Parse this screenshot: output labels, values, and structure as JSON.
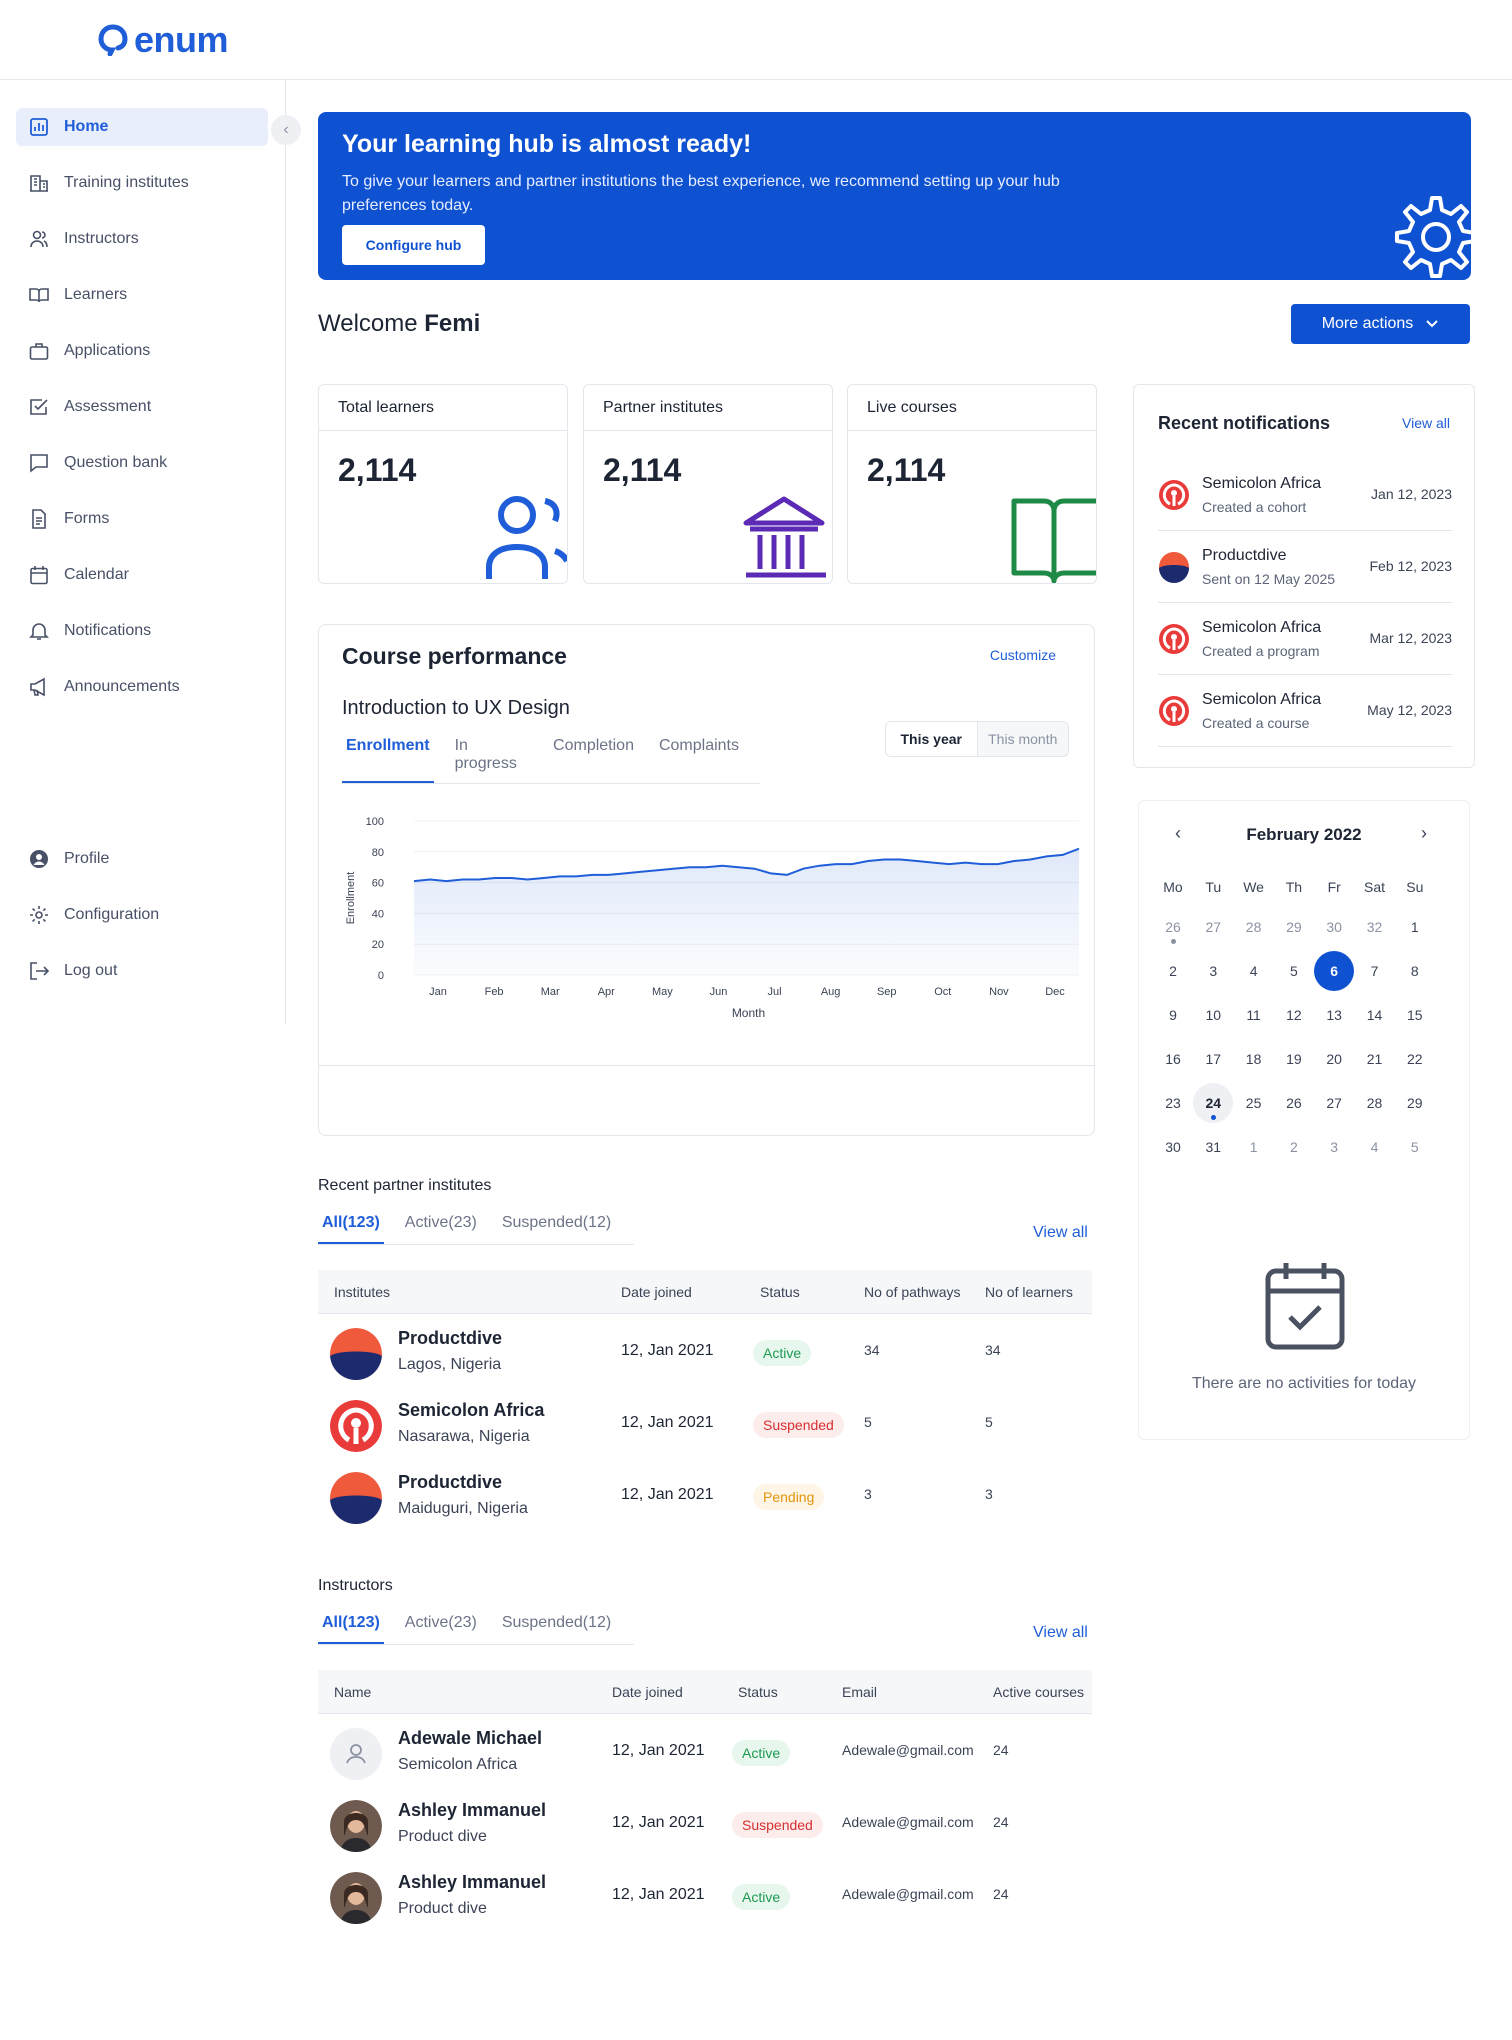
{
  "brand": {
    "name": "enum"
  },
  "sidebar": {
    "items": [
      {
        "label": "Home",
        "icon": "chart-icon"
      },
      {
        "label": "Training institutes",
        "icon": "building-icon"
      },
      {
        "label": "Instructors",
        "icon": "users-icon"
      },
      {
        "label": "Learners",
        "icon": "book-icon"
      },
      {
        "label": "Applications",
        "icon": "briefcase-icon"
      },
      {
        "label": "Assessment",
        "icon": "checkbox-icon"
      },
      {
        "label": "Question bank",
        "icon": "message-icon"
      },
      {
        "label": "Forms",
        "icon": "document-icon"
      },
      {
        "label": "Calendar",
        "icon": "calendar-icon"
      },
      {
        "label": "Notifications",
        "icon": "bell-icon"
      },
      {
        "label": "Announcements",
        "icon": "megaphone-icon"
      }
    ],
    "bottom": [
      {
        "label": "Profile",
        "icon": "profile-icon"
      },
      {
        "label": "Configuration",
        "icon": "gear-icon"
      },
      {
        "label": "Log out",
        "icon": "logout-icon"
      }
    ]
  },
  "banner": {
    "title": "Your learning hub is almost ready!",
    "text": "To give your learners and partner institutions the best experience, we recommend setting up your hub preferences today.",
    "button": "Configure hub"
  },
  "welcome": {
    "prefix": "Welcome ",
    "name": "Femi"
  },
  "more_actions": "More actions",
  "stats": [
    {
      "label": "Total learners",
      "value": "2,114"
    },
    {
      "label": "Partner institutes",
      "value": "2,114"
    },
    {
      "label": "Live courses",
      "value": "2,114"
    }
  ],
  "notifications": {
    "title": "Recent notifications",
    "view_all": "View all",
    "items": [
      {
        "name": "Semicolon Africa",
        "desc": "Created a cohort",
        "date": "Jan 12, 2023"
      },
      {
        "name": "Productdive",
        "desc": "Sent on 12 May 2025",
        "date": "Feb 12, 2023"
      },
      {
        "name": "Semicolon Africa",
        "desc": "Created a program",
        "date": "Mar 12, 2023"
      },
      {
        "name": "Semicolon Africa",
        "desc": "Created a course",
        "date": "May 12, 2023"
      }
    ]
  },
  "performance": {
    "title": "Course performance",
    "customize": "Customize",
    "course": "Introduction to UX Design",
    "tabs": [
      "Enrollment",
      "In progress",
      "Completion",
      "Complaints"
    ],
    "period": [
      "This year",
      "This month"
    ]
  },
  "chart_data": {
    "type": "area",
    "xlabel": "Month",
    "ylabel": "Enrollment",
    "ylim": [
      0,
      100
    ],
    "yticks": [
      0,
      20,
      40,
      60,
      80,
      100
    ],
    "categories": [
      "Jan",
      "Feb",
      "Mar",
      "Apr",
      "May",
      "Jun",
      "Jul",
      "Aug",
      "Sep",
      "Oct",
      "Nov",
      "Dec"
    ],
    "series": [
      {
        "values": [
          61,
          62,
          61,
          62,
          62,
          63,
          63,
          62,
          63,
          64,
          64,
          65,
          65,
          66,
          67,
          68,
          69,
          70,
          70,
          71,
          70,
          69,
          66,
          65,
          69,
          71,
          72,
          72,
          74,
          75,
          75,
          74,
          73,
          72,
          73,
          72,
          72,
          74,
          75,
          77,
          78,
          82
        ]
      }
    ],
    "color": "#1f5ed8"
  },
  "calendar": {
    "title": "February 2022",
    "dow": [
      "Mo",
      "Tu",
      "We",
      "Th",
      "Fr",
      "Sat",
      "Su"
    ],
    "weeks": [
      [
        "26",
        "27",
        "28",
        "29",
        "30",
        "32",
        "1"
      ],
      [
        "2",
        "3",
        "4",
        "5",
        "6",
        "7",
        "8"
      ],
      [
        "9",
        "10",
        "11",
        "12",
        "13",
        "14",
        "15"
      ],
      [
        "16",
        "17",
        "18",
        "19",
        "20",
        "21",
        "22"
      ],
      [
        "23",
        "24",
        "25",
        "26",
        "27",
        "28",
        "29"
      ],
      [
        "30",
        "31",
        "1",
        "2",
        "3",
        "4",
        "5"
      ]
    ],
    "selected": "6",
    "today": "24",
    "empty": "There are no activities for today"
  },
  "partners": {
    "title": "Recent partner institutes",
    "tabs": [
      "All(123)",
      "Active(23)",
      "Suspended(12)"
    ],
    "view_all": "View all",
    "columns": [
      "Institutes",
      "Date joined",
      "Status",
      "No of pathways",
      "No of learners"
    ],
    "rows": [
      {
        "name": "Productdive",
        "location": "Lagos, Nigeria",
        "date": "12, Jan 2021",
        "status": "Active",
        "pathways": "34",
        "learners": "34"
      },
      {
        "name": "Semicolon Africa",
        "location": "Nasarawa, Nigeria",
        "date": "12, Jan 2021",
        "status": "Suspended",
        "pathways": "5",
        "learners": "5"
      },
      {
        "name": "Productdive",
        "location": "Maiduguri, Nigeria",
        "date": "12, Jan 2021",
        "status": "Pending",
        "pathways": "3",
        "learners": "3"
      }
    ]
  },
  "instructors": {
    "title": "Instructors",
    "tabs": [
      "All(123)",
      "Active(23)",
      "Suspended(12)"
    ],
    "view_all": "View all",
    "columns": [
      "Name",
      "Date joined",
      "Status",
      "Email",
      "Active courses"
    ],
    "rows": [
      {
        "name": "Adewale Michael",
        "org": "Semicolon Africa",
        "date": "12, Jan 2021",
        "status": "Active",
        "email": "Adewale@gmail.com",
        "courses": "24"
      },
      {
        "name": "Ashley Immanuel",
        "org": "Product dive",
        "date": "12, Jan 2021",
        "status": "Suspended",
        "email": "Adewale@gmail.com",
        "courses": "24"
      },
      {
        "name": "Ashley Immanuel",
        "org": "Product dive",
        "date": "12, Jan 2021",
        "status": "Active",
        "email": "Adewale@gmail.com",
        "courses": "24"
      }
    ]
  }
}
